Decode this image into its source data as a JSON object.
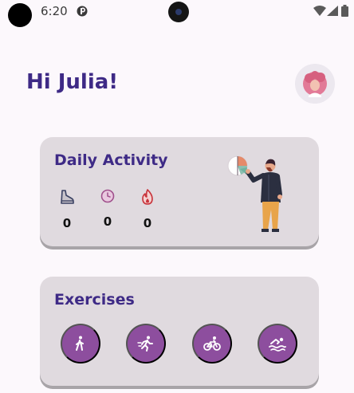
{
  "status_bar": {
    "time": "6:20"
  },
  "header": {
    "greeting": "Hi Julia!"
  },
  "daily_activity": {
    "title": "Daily Activity",
    "stats": [
      {
        "icon": "shoe-icon",
        "value": "0"
      },
      {
        "icon": "clock-icon",
        "value": "0"
      },
      {
        "icon": "flame-icon",
        "value": "0"
      }
    ]
  },
  "exercises": {
    "title": "Exercises",
    "items": [
      {
        "icon": "walk-icon"
      },
      {
        "icon": "run-icon"
      },
      {
        "icon": "bike-icon"
      },
      {
        "icon": "swim-icon"
      }
    ]
  },
  "colors": {
    "accent": "#3e2a86",
    "card": "#e0dadf",
    "exercise_button": "#8d4e9e"
  }
}
